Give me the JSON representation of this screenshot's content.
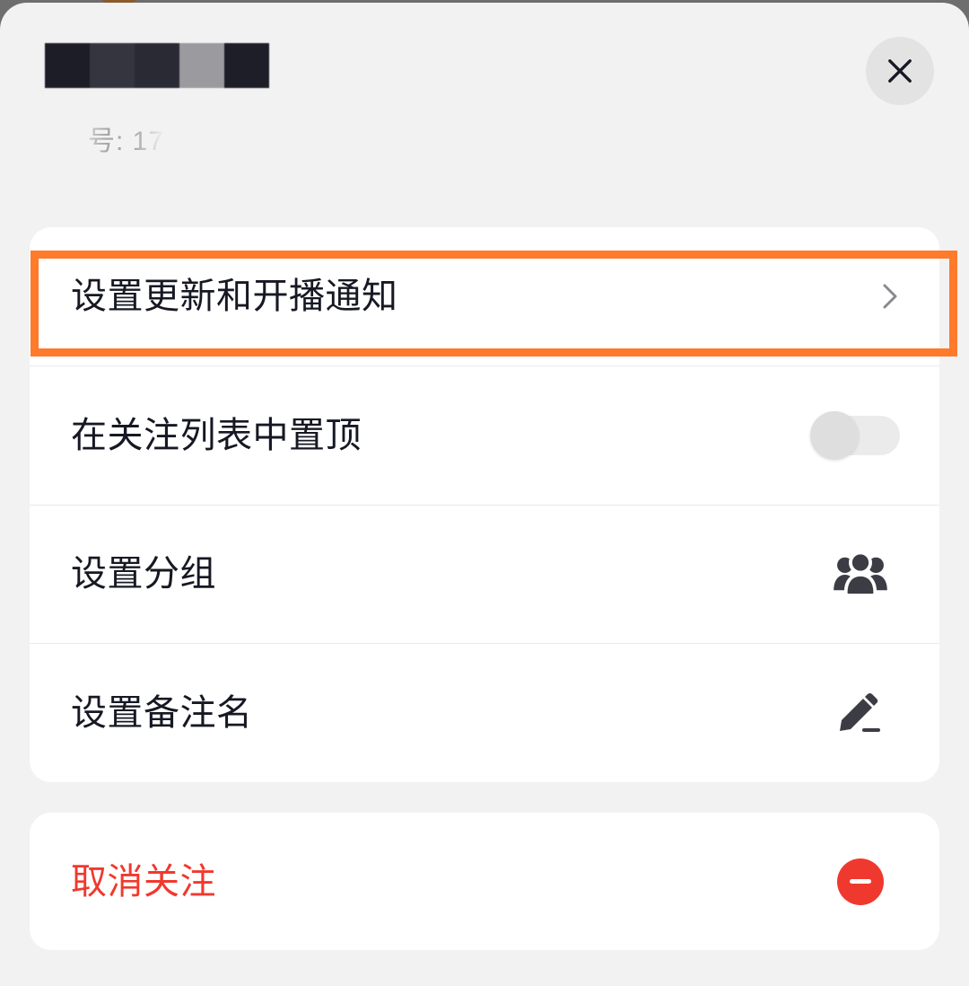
{
  "header": {
    "account_id_text": "号: 17",
    "close_icon": "close-icon"
  },
  "settings": {
    "items": [
      {
        "label": "设置更新和开播通知",
        "icon": "chevron-right-icon"
      },
      {
        "label": "在关注列表中置顶",
        "icon": "toggle-switch-icon",
        "enabled": false
      },
      {
        "label": "设置分组",
        "icon": "group-icon"
      },
      {
        "label": "设置备注名",
        "icon": "pencil-icon"
      }
    ]
  },
  "unfollow": {
    "label": "取消关注",
    "icon": "minus-circle-icon"
  },
  "colors": {
    "background": "#F2F2F2",
    "card": "#FFFFFF",
    "text_primary": "#161823",
    "danger": "#F0392E",
    "highlight_border": "#FF7A2A",
    "icon_gray": "#3C3C44"
  }
}
